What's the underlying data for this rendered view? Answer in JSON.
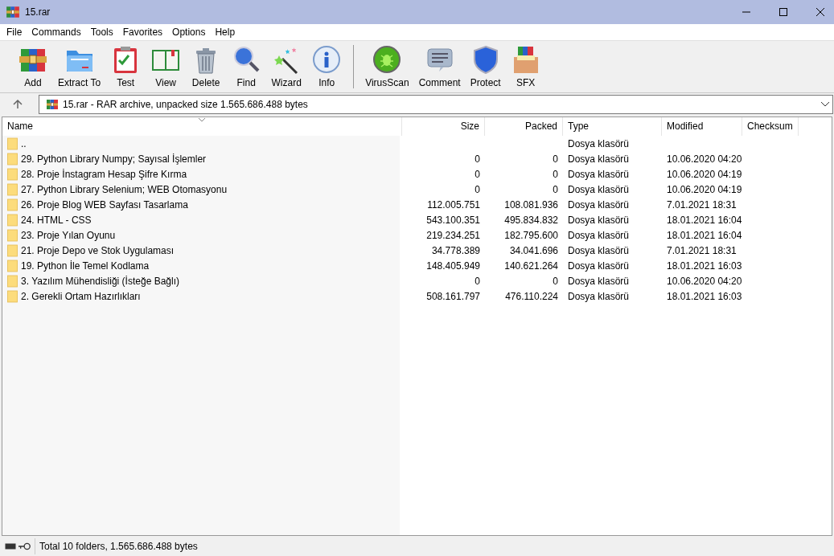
{
  "window": {
    "title": "15.rar"
  },
  "menu": [
    "File",
    "Commands",
    "Tools",
    "Favorites",
    "Options",
    "Help"
  ],
  "toolbar": [
    {
      "label": "Add",
      "kind": "tool"
    },
    {
      "label": "Extract To",
      "kind": "tool"
    },
    {
      "label": "Test",
      "kind": "tool"
    },
    {
      "label": "View",
      "kind": "tool"
    },
    {
      "label": "Delete",
      "kind": "tool"
    },
    {
      "label": "Find",
      "kind": "tool"
    },
    {
      "label": "Wizard",
      "kind": "tool"
    },
    {
      "label": "Info",
      "kind": "tool"
    },
    {
      "label": "VirusScan",
      "kind": "extra"
    },
    {
      "label": "Comment",
      "kind": "extra"
    },
    {
      "label": "Protect",
      "kind": "extra"
    },
    {
      "label": "SFX",
      "kind": "extra"
    }
  ],
  "address": {
    "value": "15.rar - RAR archive, unpacked size 1.565.686.488 bytes"
  },
  "table": {
    "columns": [
      "Name",
      "Size",
      "Packed",
      "Type",
      "Modified",
      "Checksum"
    ],
    "rows": [
      [
        "..",
        "",
        "",
        "Dosya klasörü",
        "",
        ""
      ],
      [
        "29. Python Library Numpy; Sayısal İşlemler",
        "0",
        "0",
        "Dosya klasörü",
        "10.06.2020 04:20",
        ""
      ],
      [
        "28. Proje İnstagram Hesap Şifre Kırma",
        "0",
        "0",
        "Dosya klasörü",
        "10.06.2020 04:19",
        ""
      ],
      [
        "27. Python Library Selenium; WEB Otomasyonu",
        "0",
        "0",
        "Dosya klasörü",
        "10.06.2020 04:19",
        ""
      ],
      [
        "26. Proje Blog WEB Sayfası Tasarlama",
        "112.005.751",
        "108.081.936",
        "Dosya klasörü",
        "7.01.2021 18:31",
        ""
      ],
      [
        "24. HTML - CSS",
        "543.100.351",
        "495.834.832",
        "Dosya klasörü",
        "18.01.2021 16:04",
        ""
      ],
      [
        "23. Proje Yılan Oyunu",
        "219.234.251",
        "182.795.600",
        "Dosya klasörü",
        "18.01.2021 16:04",
        ""
      ],
      [
        "21. Proje Depo ve Stok Uygulaması",
        "34.778.389",
        "34.041.696",
        "Dosya klasörü",
        "7.01.2021 18:31",
        ""
      ],
      [
        "19. Python İle Temel Kodlama",
        "148.405.949",
        "140.621.264",
        "Dosya klasörü",
        "18.01.2021 16:03",
        ""
      ],
      [
        "3. Yazılım Mühendisliği (İsteğe Bağlı)",
        "0",
        "0",
        "Dosya klasörü",
        "10.06.2020 04:20",
        ""
      ],
      [
        "2. Gerekli Ortam Hazırlıkları",
        "508.161.797",
        "476.110.224",
        "Dosya klasörü",
        "18.01.2021 16:03",
        ""
      ]
    ]
  },
  "status_bar": {
    "text": "Total 10 folders, 1.565.686.488 bytes"
  }
}
